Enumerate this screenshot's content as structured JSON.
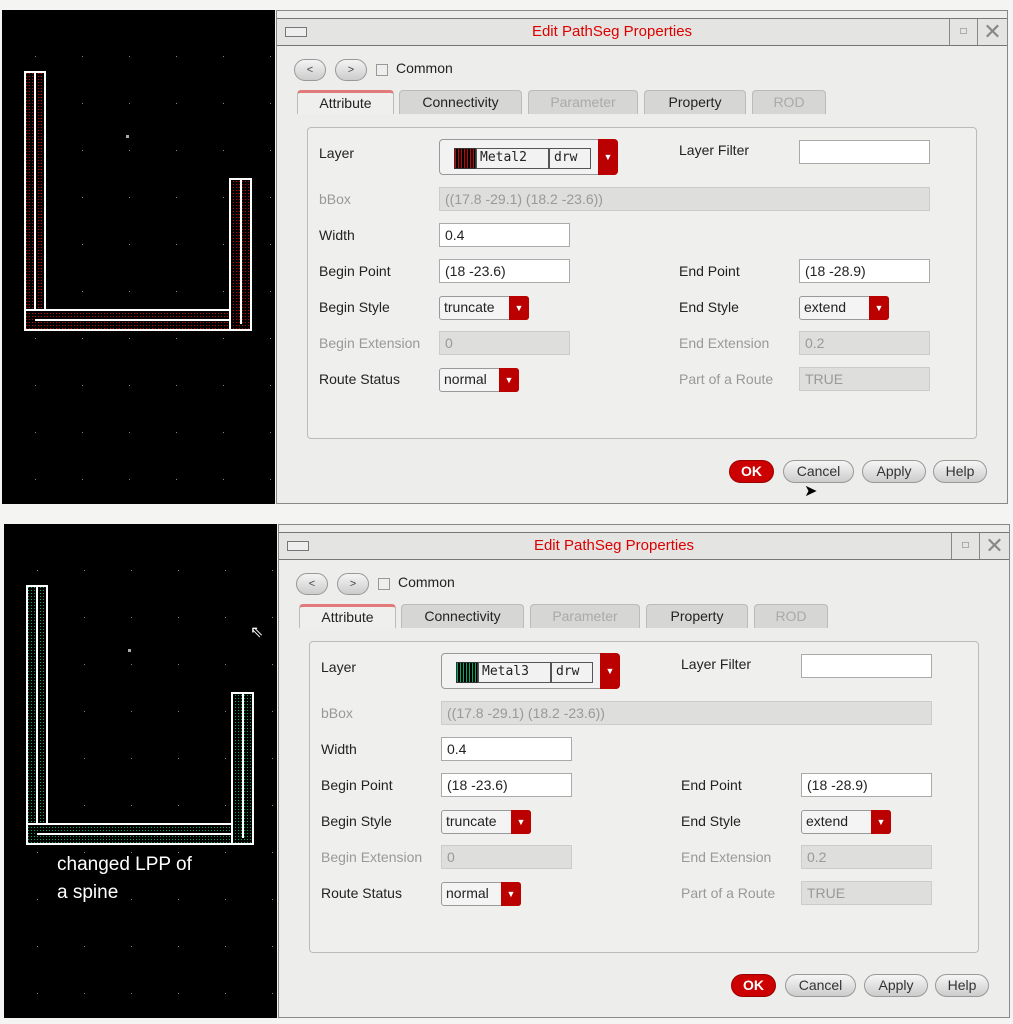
{
  "panels": [
    {
      "title": "Edit PathSeg Properties",
      "nav_prev": "<",
      "nav_next": ">",
      "common_label": "Common",
      "tabs": [
        "Attribute",
        "Connectivity",
        "Parameter",
        "Property",
        "ROD"
      ],
      "layer_label": "Layer",
      "layer_name": "Metal2",
      "layer_purpose": "drw",
      "layer_color": "#cc0000",
      "layer_filter_label": "Layer Filter",
      "layer_filter_value": "",
      "bbox_label": "bBox",
      "bbox_value": "((17.8 -29.1) (18.2 -23.6))",
      "width_label": "Width",
      "width_value": "0.4",
      "begin_point_label": "Begin Point",
      "begin_point_value": "(18 -23.6)",
      "end_point_label": "End Point",
      "end_point_value": "(18 -28.9)",
      "begin_style_label": "Begin Style",
      "begin_style_value": "truncate",
      "end_style_label": "End Style",
      "end_style_value": "extend",
      "begin_ext_label": "Begin Extension",
      "begin_ext_value": "0",
      "end_ext_label": "End Extension",
      "end_ext_value": "0.2",
      "route_status_label": "Route Status",
      "route_status_value": "normal",
      "part_route_label": "Part of a Route",
      "part_route_value": "TRUE",
      "buttons": {
        "ok": "OK",
        "cancel": "Cancel",
        "apply": "Apply",
        "help": "Help"
      },
      "note": ""
    },
    {
      "title": "Edit PathSeg Properties",
      "nav_prev": "<",
      "nav_next": ">",
      "common_label": "Common",
      "tabs": [
        "Attribute",
        "Connectivity",
        "Parameter",
        "Property",
        "ROD"
      ],
      "layer_label": "Layer",
      "layer_name": "Metal3",
      "layer_purpose": "drw",
      "layer_color": "#00aa66",
      "layer_filter_label": "Layer Filter",
      "layer_filter_value": "",
      "bbox_label": "bBox",
      "bbox_value": "((17.8 -29.1) (18.2 -23.6))",
      "width_label": "Width",
      "width_value": "0.4",
      "begin_point_label": "Begin Point",
      "begin_point_value": "(18 -23.6)",
      "end_point_label": "End Point",
      "end_point_value": "(18 -28.9)",
      "begin_style_label": "Begin Style",
      "begin_style_value": "truncate",
      "end_style_label": "End Style",
      "end_style_value": "extend",
      "begin_ext_label": "Begin Extension",
      "begin_ext_value": "0",
      "end_ext_label": "End Extension",
      "end_ext_value": "0.2",
      "route_status_label": "Route Status",
      "route_status_value": "normal",
      "part_route_label": "Part of a Route",
      "part_route_value": "TRUE",
      "buttons": {
        "ok": "OK",
        "cancel": "Cancel",
        "apply": "Apply",
        "help": "Help"
      },
      "note": "changed LPP of\na spine"
    }
  ]
}
